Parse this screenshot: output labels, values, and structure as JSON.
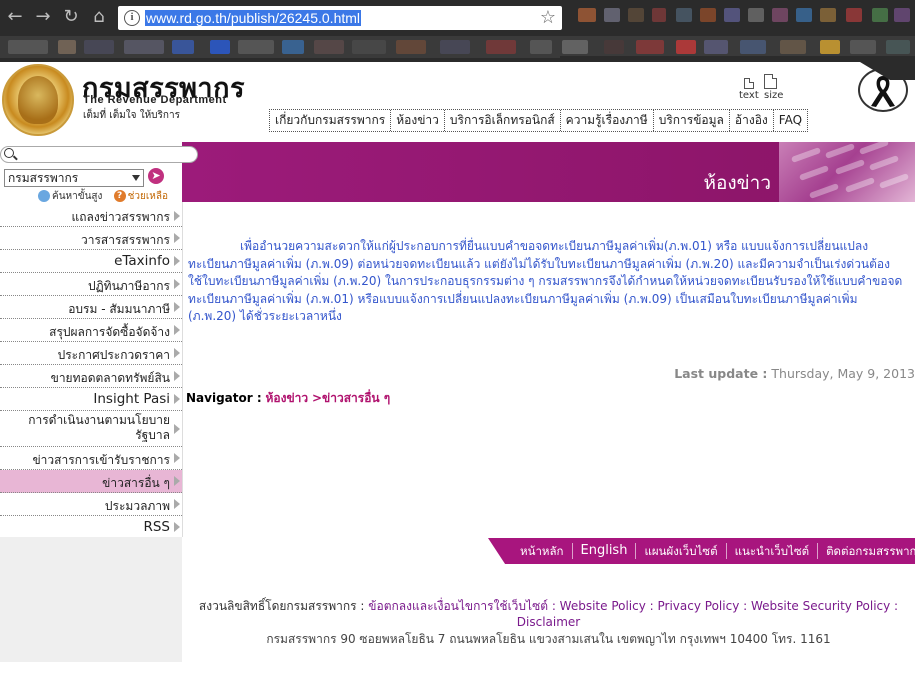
{
  "browser": {
    "url": "www.rd.go.th/publish/26245.0.html",
    "back_icon": "back-arrow-icon",
    "forward_icon": "forward-arrow-icon",
    "reload_icon": "reload-icon",
    "home_icon": "home-icon"
  },
  "header": {
    "title_th": "กรมสรรพากร",
    "title_en": "The Revenue Department",
    "tagline": "เต็มที่ เต็มใจ ให้บริการ",
    "tools": {
      "text_label": "text",
      "size_label": "size"
    },
    "nav": [
      "เกี่ยวกับกรมสรรพากร",
      "ห้องข่าว",
      "บริการอิเล็กทรอนิกส์",
      "ความรู้เรื่องภาษี",
      "บริการข้อมูล",
      "อ้างอิง",
      "FAQ"
    ]
  },
  "sidebar": {
    "search_placeholder": "",
    "select_value": "กรมสรรพากร",
    "advanced_search": "ค้นหาขั้นสูง",
    "help": "ช่วยเหลือ",
    "items": [
      {
        "label": "แถลงข่าวสรรพากร",
        "big": false
      },
      {
        "label": "วารสารสรรพากร",
        "big": false
      },
      {
        "label": "eTaxinfo",
        "big": true
      },
      {
        "label": "ปฏิทินภาษีอากร",
        "big": false
      },
      {
        "label": "อบรม - สัมมนาภาษี",
        "big": false
      },
      {
        "label": "สรุปผลการจัดซื้อจัดจ้าง",
        "big": false
      },
      {
        "label": "ประกาศประกวดราคา",
        "big": false
      },
      {
        "label": "ขายทอดตลาดทรัพย์สิน",
        "big": false
      },
      {
        "label": "Insight Pasi",
        "big": true
      },
      {
        "label": "การดำเนินงานตามนโยบายรัฐบาล",
        "big": false
      },
      {
        "label": "ข่าวสารการเข้ารับราชการ",
        "big": false
      },
      {
        "label": "ข่าวสารอื่น ๆ",
        "big": false
      },
      {
        "label": "ประมวลภาพ",
        "big": false
      },
      {
        "label": "RSS",
        "big": true
      }
    ]
  },
  "main": {
    "banner_title": "ห้องข่าว",
    "paragraph": "เพื่ออำนวยความสะดวกให้แก่ผู้ประกอบการที่ยื่นแบบคำขอจดทะเบียนภาษีมูลค่าเพิ่ม(ภ.พ.01) หรือ แบบแจ้งการเปลี่ยนแปลงทะเบียนภาษีมูลค่าเพิ่ม (ภ.พ.09) ต่อหน่วยจดทะเบียนแล้ว แต่ยังไม่ได้รับใบทะเบียนภาษีมูลค่าเพิ่ม (ภ.พ.20) และมีความจำเป็นเร่งด่วนต้องใช้ใบทะเบียนภาษีมูลค่าเพิ่ม (ภ.พ.20) ในการประกอบธุรกรรมต่าง ๆ กรมสรรพากรจึงได้กำหนดให้หน่วยจดทะเบียนรับรองให้ใช้แบบคำขอจดทะเบียนภาษีมูลค่าเพิ่ม (ภ.พ.01) หรือแบบแจ้งการเปลี่ยนแปลงทะเบียนภาษีมูลค่าเพิ่ม (ภ.พ.09) เป็นเสมือนใบทะเบียนภาษีมูลค่าเพิ่ม (ภ.พ.20) ได้ชั่วระยะเวลาหนึ่ง",
    "last_update_label": "Last update :",
    "last_update_value": "Thursday, May 9, 2013",
    "navigator_label": "Navigator :",
    "navigator_crumb_1": "ห้องข่าว",
    "navigator_sep": ">",
    "navigator_crumb_2": "ข่าวสารอื่น ๆ"
  },
  "footer": {
    "links": [
      "หน้าหลัก",
      "English",
      "แผนผังเว็บไซต์",
      "แนะนำเว็บไซต์",
      "ติดต่อกรมสรรพากร"
    ],
    "copyright_prefix": "สงวนลิขสิทธิ์โดยกรมสรรพากร :",
    "policy_links": "ข้อตกลงและเงื่อนไขการใช้เว็บไซต์ : Website Policy : Privacy Policy : Website Security Policy : Disclaimer",
    "address": "กรมสรรพากร 90 ซอยพหลโยธิน 7 ถนนพหลโยธิน แขวงสามเสนใน เขตพญาไท กรุงเทพฯ 10400 โทร. 1161"
  },
  "colors": {
    "brand_magenta": "#a8157e",
    "link_blue": "#3355cc",
    "crumb_magenta": "#b0126e",
    "active_menu": "#e8b6d5"
  }
}
